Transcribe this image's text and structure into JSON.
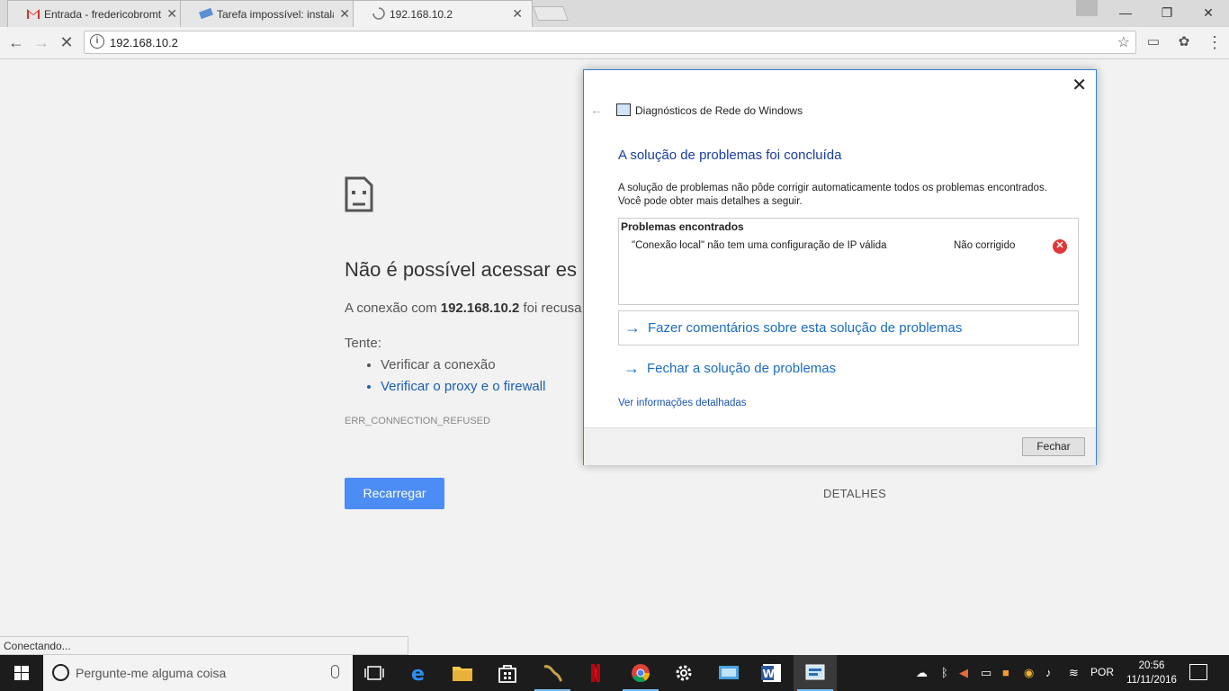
{
  "browser": {
    "tabs": [
      {
        "label": "Entrada - fredericobromt",
        "icon": "gmail-icon"
      },
      {
        "label": "Tarefa impossível: instala",
        "icon": "page-icon"
      },
      {
        "label": "192.168.10.2",
        "icon": "loading-icon"
      }
    ],
    "address": "192.168.10.2",
    "status": "Conectando..."
  },
  "error_page": {
    "title": "Não é possível acessar es",
    "message_prefix": "A conexão com ",
    "message_host": "192.168.10.2",
    "message_suffix": " foi recusa",
    "try_label": "Tente:",
    "tips": [
      "Verificar a conexão",
      "Verificar o proxy e o firewall"
    ],
    "code": "ERR_CONNECTION_REFUSED",
    "reload_label": "Recarregar",
    "details_label": "DETALHES"
  },
  "dialog": {
    "app_title": "Diagnósticos de Rede do Windows",
    "heading": "A solução de problemas foi concluída",
    "description_line1": "A solução de problemas não pôde corrigir automaticamente todos os problemas encontrados.",
    "description_line2": "Você pode obter mais detalhes a seguir.",
    "problems_header": "Problemas encontrados",
    "problem_name": "\"Conexão local\" não tem uma configuração de IP válida",
    "problem_status": "Não corrigido",
    "link_feedback": "Fazer comentários sobre esta solução de problemas",
    "link_close": "Fechar a solução de problemas",
    "more_info": "Ver informações detalhadas",
    "close_button": "Fechar"
  },
  "taskbar": {
    "search_placeholder": "Pergunte-me alguma coisa",
    "language": "POR",
    "time": "20:56",
    "date": "11/11/2016"
  },
  "colors": {
    "accent": "#4c8cf5",
    "dialog_heading": "#1a3d9e",
    "link": "#1a6cc2"
  }
}
